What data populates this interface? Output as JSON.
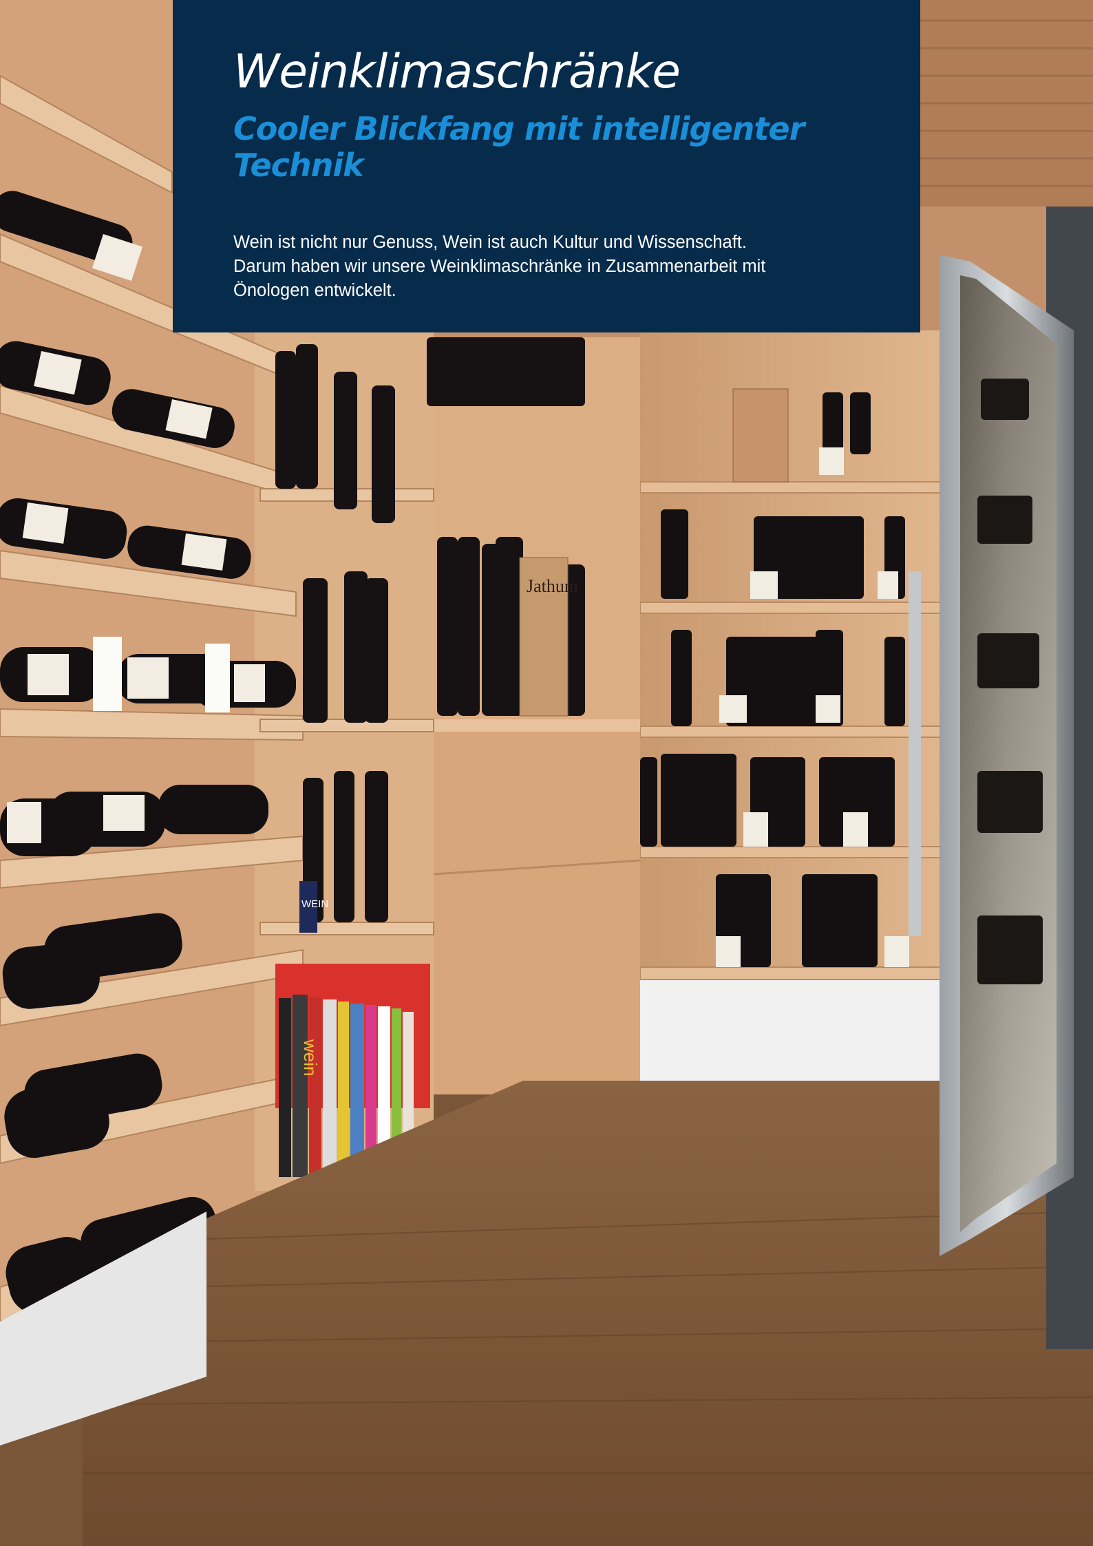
{
  "header": {
    "title": "Weinklimaschränke",
    "subtitle": "Cooler Blickfang mit intelligenter Technik",
    "body_lines": [
      "Wein ist nicht nur Genuss, Wein ist auch Kultur und Wissenschaft.",
      "Darum haben wir unsere Weinklimaschränke in Zusammenarbeit mit",
      "Önologen entwickelt."
    ]
  },
  "photo": {
    "book_spine_text": "wein",
    "box_label": "Jathum",
    "bottle_label": "WEIN"
  },
  "colors": {
    "panel": "#062b4b",
    "subtitle": "#1a8fd8",
    "wood": "#d6a982",
    "floor": "#7a5638"
  }
}
